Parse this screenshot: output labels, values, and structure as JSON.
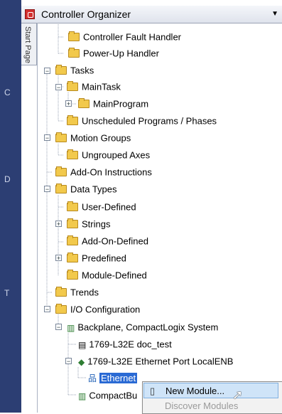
{
  "panel": {
    "title": "Controller Organizer",
    "side_tab": "Start Page"
  },
  "left_strip_marks": [
    "C",
    "D",
    "T"
  ],
  "tree": [
    {
      "label": "Controller Fault Handler"
    },
    {
      "label": "Power-Up Handler"
    },
    {
      "label": "Tasks"
    },
    {
      "label": "MainTask"
    },
    {
      "label": "MainProgram"
    },
    {
      "label": "Unscheduled Programs / Phases"
    },
    {
      "label": "Motion Groups"
    },
    {
      "label": "Ungrouped Axes"
    },
    {
      "label": "Add-On Instructions"
    },
    {
      "label": "Data Types"
    },
    {
      "label": "User-Defined"
    },
    {
      "label": "Strings"
    },
    {
      "label": "Add-On-Defined"
    },
    {
      "label": "Predefined"
    },
    {
      "label": "Module-Defined"
    },
    {
      "label": "Trends"
    },
    {
      "label": "I/O Configuration"
    },
    {
      "label": "Backplane, CompactLogix System"
    },
    {
      "label": "1769-L32E doc_test"
    },
    {
      "label": "1769-L32E Ethernet Port LocalENB"
    },
    {
      "label": "Ethernet"
    },
    {
      "label": "CompactBu"
    }
  ],
  "context_menu": [
    {
      "label": "New Module...",
      "state": "highlighted"
    },
    {
      "label": "Discover Modules",
      "state": "disabled"
    }
  ]
}
